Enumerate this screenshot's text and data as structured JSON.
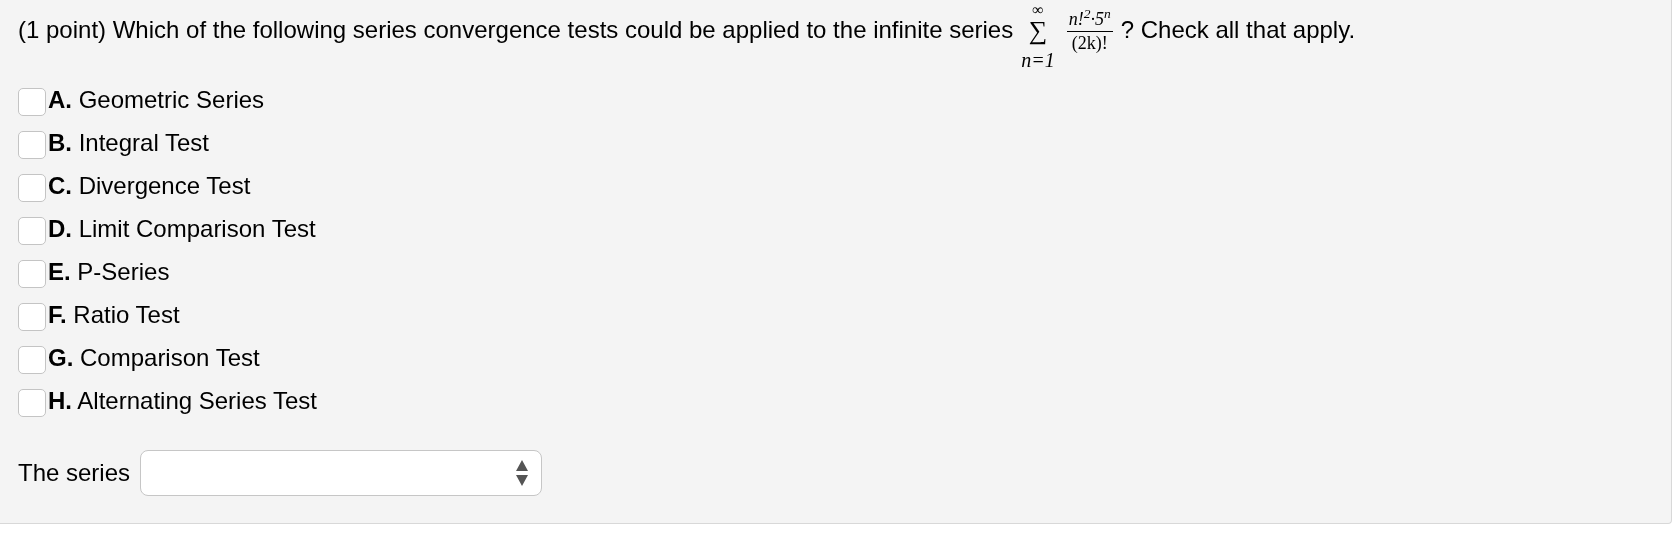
{
  "question": {
    "prefix": "(1 point) Which of the following series convergence tests could be applied to the infinite series",
    "math": {
      "symbol": "∑",
      "upper": "∞",
      "lower": "n=1",
      "numerator": "n!$^{2}$·5$^{n}$",
      "denominator": "(2k)!"
    },
    "suffix": "? Check all that apply."
  },
  "options": [
    {
      "label": "**A.** Geometric Series",
      "checked": false
    },
    {
      "label": "**B.** Integral Test",
      "checked": false
    },
    {
      "label": "**C.** Divergence Test",
      "checked": false
    },
    {
      "label": "**D.** Limit Comparison Test",
      "checked": false
    },
    {
      "label": "**E.** P-Series",
      "checked": false
    },
    {
      "label": "**F.** Ratio Test",
      "checked": false
    },
    {
      "label": "**G.** Comparison Test",
      "checked": false
    },
    {
      "label": "**H.** Alternating Series Test",
      "checked": false
    }
  ],
  "answer": {
    "label": "The series"
  }
}
